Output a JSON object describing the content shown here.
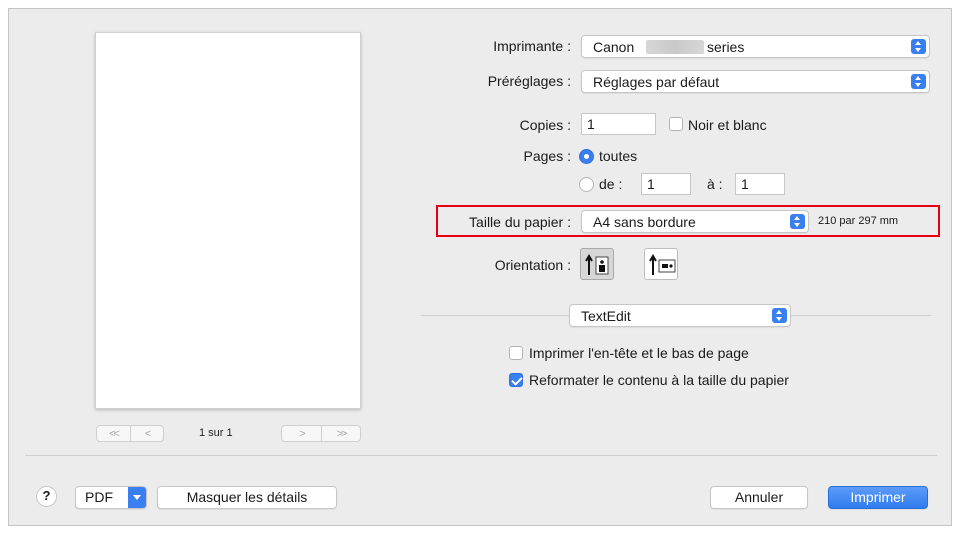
{
  "printer": {
    "label": "Imprimante :",
    "value_prefix": "Canon",
    "value_suffix": "series"
  },
  "presets": {
    "label": "Préréglages :",
    "value": "Réglages par défaut"
  },
  "copies": {
    "label": "Copies :",
    "value": "1",
    "bw_label": "Noir et blanc"
  },
  "pages": {
    "label": "Pages :",
    "all_label": "toutes",
    "from_label": "de :",
    "from_value": "1",
    "to_label": "à :",
    "to_value": "1"
  },
  "paper_size": {
    "label": "Taille du papier :",
    "value": "A4 sans bordure",
    "dimensions": "210 par 297 mm"
  },
  "orientation": {
    "label": "Orientation :"
  },
  "app_menu": {
    "value": "TextEdit"
  },
  "options": {
    "header_footer": "Imprimer l'en-tête et le bas de page",
    "header_footer_checked": false,
    "rewrap": "Reformater le contenu à la taille du papier",
    "rewrap_checked": true
  },
  "preview_nav": {
    "first": "<<",
    "prev": "<",
    "page_count": "1 sur 1",
    "next": ">",
    "last": ">>"
  },
  "footer": {
    "help": "?",
    "pdf": "PDF",
    "hide_details": "Masquer les détails",
    "cancel": "Annuler",
    "print": "Imprimer"
  },
  "colors": {
    "accent": "#3a7ff0",
    "highlight": "#e60012",
    "dialog_bg": "#ececec"
  }
}
